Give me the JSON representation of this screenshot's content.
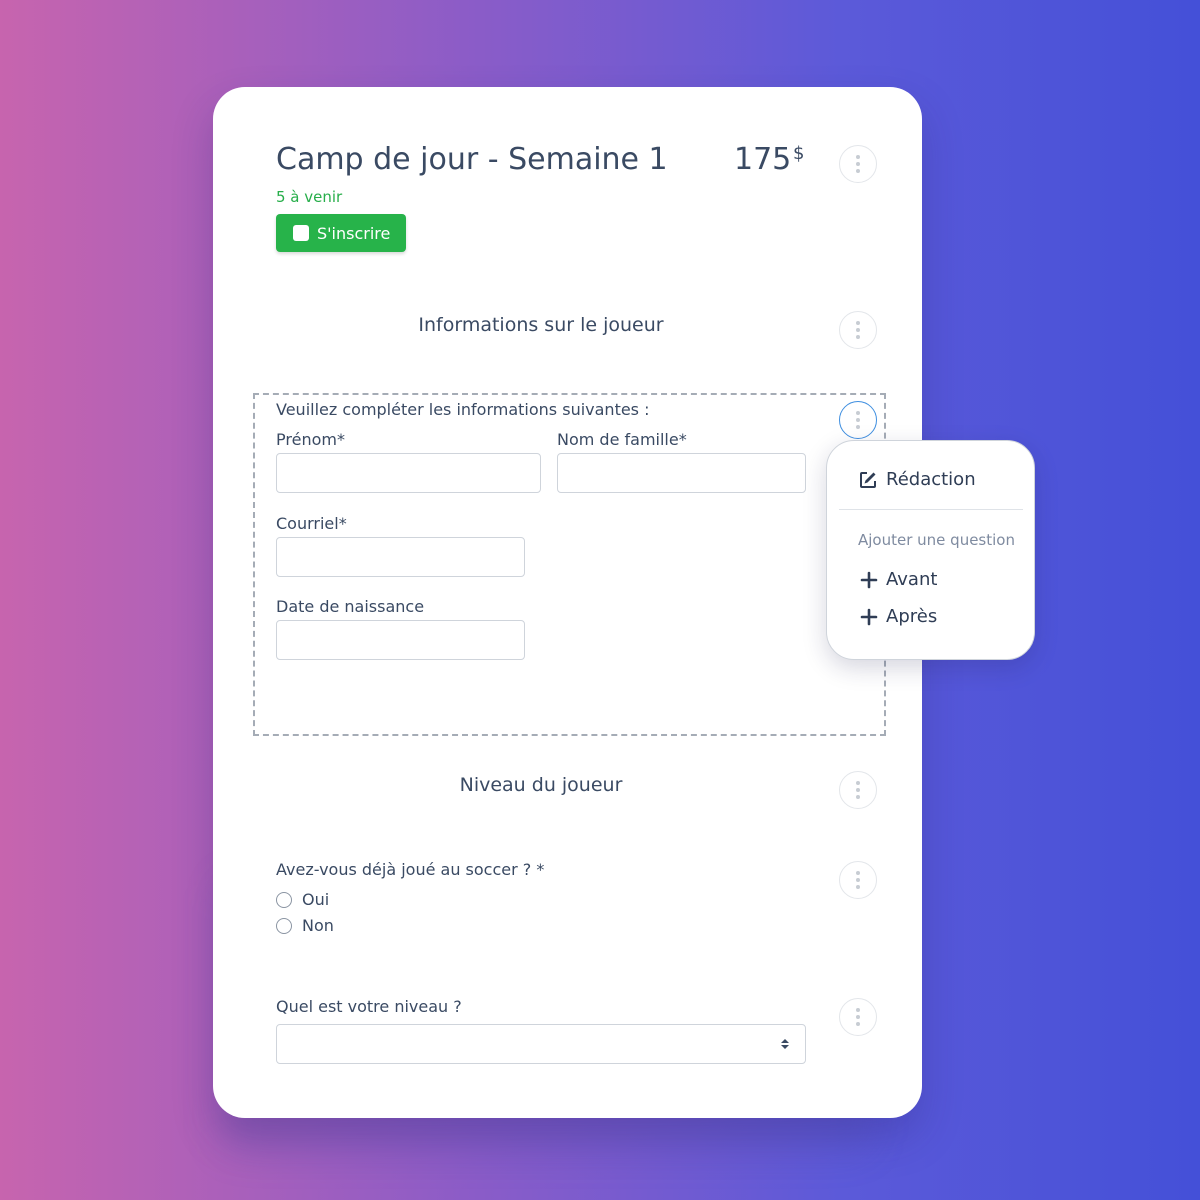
{
  "event": {
    "title": "Camp de jour - Semaine 1",
    "price": "175",
    "currency": "$",
    "upcoming": "5 à venir",
    "register_label": "S'inscrire"
  },
  "sections": {
    "player_info": "Informations sur le joueur",
    "player_level": "Niveau du joueur"
  },
  "form": {
    "instruction": "Veuillez compléter les informations suivantes :",
    "first_name_label": "Prénom*",
    "last_name_label": "Nom de famille*",
    "email_label": "Courriel*",
    "birthdate_label": "Date de naissance",
    "first_name_value": "",
    "last_name_value": "",
    "email_value": "",
    "birthdate_value": ""
  },
  "questions": {
    "soccer_question": "Avez-vous déjà joué au soccer ? *",
    "options": [
      "Oui",
      "Non"
    ],
    "level_question": "Quel est votre niveau ?",
    "level_selected": ""
  },
  "menu": {
    "edit_label": "Rédaction",
    "add_question_label": "Ajouter une question",
    "before_label": "Avant",
    "after_label": "Après"
  },
  "icons": {
    "options": "more-vertical-icon",
    "edit": "edit-icon",
    "add": "plus-icon",
    "select": "select-arrows-icon"
  },
  "colors": {
    "accent_green": "#27b34a",
    "upcoming_green": "#27ae4a",
    "active_ring": "#3f8fe0"
  }
}
